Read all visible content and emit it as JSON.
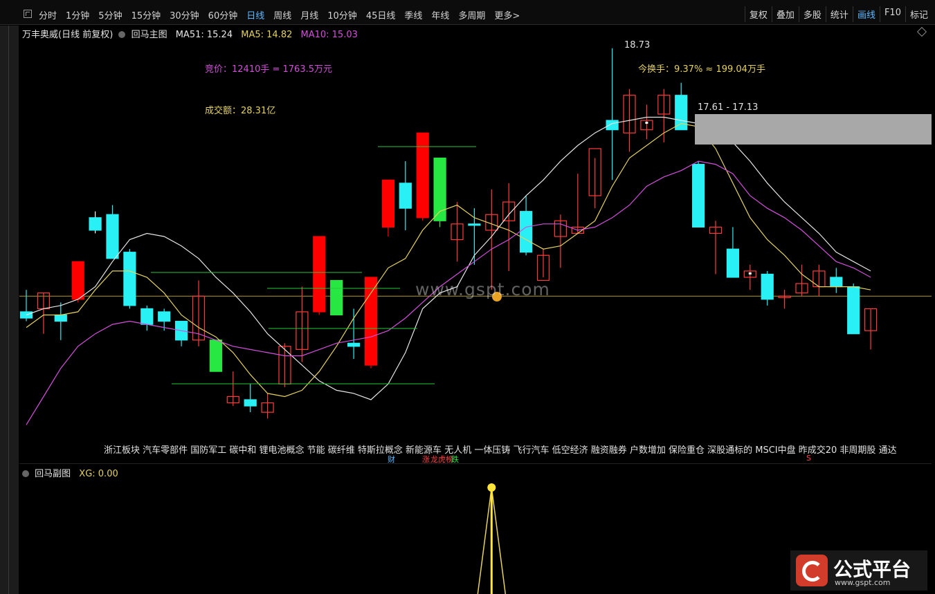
{
  "toolbar": {
    "periods": [
      "分时",
      "1分钟",
      "5分钟",
      "15分钟",
      "30分钟",
      "60分钟",
      "日线",
      "周线",
      "月线",
      "10分钟",
      "45日线",
      "季线",
      "年线",
      "多周期",
      "更多>"
    ],
    "active_period": "日线",
    "tools": [
      "复权",
      "叠加",
      "多股",
      "统计",
      "画线",
      "F10",
      "标记"
    ],
    "active_tool": "画线"
  },
  "main": {
    "stock_title": "万丰奥威(日线 前复权)",
    "indicator_name": "回马主图",
    "ma51": "MA51: 15.24",
    "ma5": "MA5: 14.82",
    "ma10": "MA10: 15.03",
    "bid_text": "竞价：12410手 = 1763.5万元",
    "amount_text": "成交额：28.31亿",
    "turnover_text": "今换手：9.37% ≈ 199.04万手",
    "high_text": "18.73",
    "range_text": "17.61 - 17.13",
    "watermark": "www.gspt.com"
  },
  "tags": {
    "text": "浙江板块 汽车零部件 国防军工 碳中和 锂电池概念 节能 碳纤维 特斯拉概念 新能源车 无人机 一体压铸 飞行汽车 低空经济 融资融券 户数增加 保险重仓 深股通标的 MSCI中盘 昨成交20 非周期股 通达",
    "sig_cai": "财",
    "sig_zhang": "涨",
    "sig_bang": "龙虎榜",
    "sig_die": "跌",
    "sig_s": "S"
  },
  "sub": {
    "indicator_name": "回马副图",
    "xg": "XG: 0.00"
  },
  "logo": {
    "text": "公式平台",
    "url": "www.gspt.com"
  },
  "colors": {
    "up_red": "#ff0000",
    "down_cyan": "#29f0f5",
    "green": "#27e843",
    "ma5": "#e6d25e",
    "ma10": "#d34fdc",
    "ma51": "#e6e6e6",
    "active": "#5cb8ff"
  },
  "chart_data": {
    "type": "candlestick",
    "y_range": [
      12.5,
      19
    ],
    "candles": [
      {
        "o": 14.55,
        "h": 14.9,
        "l": 14.4,
        "c": 14.45,
        "color": "cyan"
      },
      {
        "o": 14.6,
        "h": 14.85,
        "l": 14.2,
        "c": 14.85,
        "color": "hollow"
      },
      {
        "o": 14.5,
        "h": 14.7,
        "l": 14.1,
        "c": 14.4,
        "color": "cyan"
      },
      {
        "o": 14.75,
        "h": 15.35,
        "l": 14.7,
        "c": 15.35,
        "color": "red"
      },
      {
        "o": 16.05,
        "h": 16.15,
        "l": 15.8,
        "c": 15.85,
        "color": "white_cross"
      },
      {
        "o": 16.1,
        "h": 16.25,
        "l": 15.4,
        "c": 15.4,
        "color": "cyan"
      },
      {
        "o": 15.5,
        "h": 15.55,
        "l": 14.6,
        "c": 14.65,
        "color": "cyan"
      },
      {
        "o": 14.6,
        "h": 14.65,
        "l": 14.25,
        "c": 14.35,
        "color": "cyan"
      },
      {
        "o": 14.55,
        "h": 14.6,
        "l": 14.25,
        "c": 14.4,
        "color": "cyan"
      },
      {
        "o": 14.4,
        "h": 14.4,
        "l": 14.0,
        "c": 14.1,
        "color": "cyan"
      },
      {
        "o": 14.1,
        "h": 15.05,
        "l": 14.0,
        "c": 14.8,
        "color": "hollow"
      },
      {
        "o": 14.1,
        "h": 14.1,
        "l": 13.6,
        "c": 13.6,
        "color": "green"
      },
      {
        "o": 13.1,
        "h": 13.6,
        "l": 13.05,
        "c": 13.2,
        "color": "hollow"
      },
      {
        "o": 13.15,
        "h": 13.4,
        "l": 12.95,
        "c": 13.05,
        "color": "cyan"
      },
      {
        "o": 12.95,
        "h": 13.25,
        "l": 12.85,
        "c": 13.1,
        "color": "hollow"
      },
      {
        "o": 13.4,
        "h": 14.05,
        "l": 13.35,
        "c": 14.0,
        "color": "hollow"
      },
      {
        "o": 13.95,
        "h": 14.95,
        "l": 13.75,
        "c": 14.55,
        "color": "hollow"
      },
      {
        "o": 14.55,
        "h": 15.75,
        "l": 14.5,
        "c": 15.75,
        "color": "red"
      },
      {
        "o": 14.5,
        "h": 15.05,
        "l": 14.5,
        "c": 15.05,
        "color": "green"
      },
      {
        "o": 14.0,
        "h": 14.6,
        "l": 13.8,
        "c": 14.05,
        "color": "cyan"
      },
      {
        "o": 13.7,
        "h": 15.1,
        "l": 13.65,
        "c": 15.1,
        "color": "red"
      },
      {
        "o": 15.9,
        "h": 16.6,
        "l": 15.75,
        "c": 16.65,
        "color": "red"
      },
      {
        "o": 16.6,
        "h": 16.95,
        "l": 15.85,
        "c": 16.2,
        "color": "cyan"
      },
      {
        "o": 16.05,
        "h": 17.4,
        "l": 16.0,
        "c": 17.4,
        "color": "red"
      },
      {
        "o": 16.0,
        "h": 17.0,
        "l": 15.9,
        "c": 17.0,
        "color": "green"
      },
      {
        "o": 15.7,
        "h": 16.3,
        "l": 15.35,
        "c": 15.95,
        "color": "hollow"
      },
      {
        "o": 15.95,
        "h": 16.2,
        "l": 15.3,
        "c": 15.95,
        "color": "cyan_flat"
      },
      {
        "o": 15.85,
        "h": 16.5,
        "l": 14.9,
        "c": 16.1,
        "color": "hollow"
      },
      {
        "o": 16.0,
        "h": 16.6,
        "l": 15.2,
        "c": 16.3,
        "color": "hollow"
      },
      {
        "o": 16.15,
        "h": 16.4,
        "l": 15.45,
        "c": 15.5,
        "color": "cyan"
      },
      {
        "o": 15.45,
        "h": 15.55,
        "l": 15.1,
        "c": 15.05,
        "color": "hollow"
      },
      {
        "o": 15.75,
        "h": 16.1,
        "l": 15.25,
        "c": 16.0,
        "color": "hollow"
      },
      {
        "o": 15.8,
        "h": 16.75,
        "l": 15.8,
        "c": 15.9,
        "color": "hollow"
      },
      {
        "o": 16.4,
        "h": 17.0,
        "l": 16.2,
        "c": 17.15,
        "color": "hollow"
      },
      {
        "o": 17.45,
        "h": 18.75,
        "l": 16.65,
        "c": 17.6,
        "color": "cyan"
      },
      {
        "o": 17.4,
        "h": 18.1,
        "l": 17.1,
        "c": 18.0,
        "color": "hollow"
      },
      {
        "o": 17.6,
        "h": 17.85,
        "l": 17.3,
        "c": 17.45,
        "color": "hollow_white"
      },
      {
        "o": 17.7,
        "h": 18.1,
        "l": 17.25,
        "c": 18.0,
        "color": "hollow"
      },
      {
        "o": 18.0,
        "h": 18.2,
        "l": 17.45,
        "c": 17.45,
        "color": "cyan"
      },
      {
        "o": 16.9,
        "h": 16.95,
        "l": 15.9,
        "c": 15.9,
        "color": "cyan"
      },
      {
        "o": 15.9,
        "h": 16.0,
        "l": 15.15,
        "c": 15.8,
        "color": "hollow"
      },
      {
        "o": 15.55,
        "h": 15.9,
        "l": 15.1,
        "c": 15.1,
        "color": "cyan"
      },
      {
        "o": 15.1,
        "h": 15.3,
        "l": 14.9,
        "c": 15.2,
        "color": "hollow_white"
      },
      {
        "o": 15.15,
        "h": 15.2,
        "l": 14.65,
        "c": 14.75,
        "color": "cyan"
      },
      {
        "o": 14.8,
        "h": 14.9,
        "l": 14.6,
        "c": 14.8,
        "color": "doji"
      },
      {
        "o": 14.85,
        "h": 15.3,
        "l": 14.8,
        "c": 15.0,
        "color": "hollow"
      },
      {
        "o": 14.95,
        "h": 15.3,
        "l": 14.8,
        "c": 15.2,
        "color": "hollow"
      },
      {
        "o": 15.1,
        "h": 15.25,
        "l": 14.85,
        "c": 14.95,
        "color": "cyan"
      },
      {
        "o": 14.95,
        "h": 15.0,
        "l": 14.2,
        "c": 14.2,
        "color": "cyan"
      },
      {
        "o": 14.25,
        "h": 14.6,
        "l": 13.95,
        "c": 14.6,
        "color": "hollow"
      }
    ],
    "ma51": [
      14.5,
      14.6,
      14.65,
      14.75,
      14.95,
      15.35,
      15.7,
      15.8,
      15.75,
      15.6,
      15.4,
      15.1,
      14.85,
      14.55,
      14.2,
      13.95,
      13.7,
      13.45,
      13.3,
      13.25,
      13.15,
      13.4,
      13.9,
      14.6,
      14.85,
      14.95,
      15.45,
      15.75,
      16.1,
      16.4,
      16.65,
      16.95,
      17.2,
      17.4,
      17.55,
      17.6,
      17.65,
      17.65,
      17.6,
      17.55,
      17.55,
      17.25,
      16.95,
      16.6,
      16.3,
      16.05,
      15.8,
      15.5,
      15.35,
      15.2
    ],
    "ma5": [
      14.3,
      14.5,
      14.5,
      14.55,
      14.9,
      15.2,
      15.2,
      15.1,
      14.85,
      14.5,
      14.3,
      14.15,
      13.9,
      13.55,
      13.25,
      13.2,
      13.3,
      13.6,
      14.0,
      14.45,
      14.85,
      15.25,
      15.4,
      15.85,
      16.15,
      16.25,
      16.05,
      15.95,
      15.85,
      15.7,
      15.55,
      15.6,
      15.8,
      16.0,
      16.55,
      17.0,
      17.2,
      17.4,
      17.55,
      17.5,
      17.15,
      16.6,
      16.05,
      15.7,
      15.45,
      15.15,
      14.95,
      14.95,
      14.95,
      14.9
    ],
    "ma10": [
      12.75,
      13.2,
      13.65,
      14.0,
      14.2,
      14.35,
      14.4,
      14.35,
      14.3,
      14.25,
      14.2,
      14.1,
      14.0,
      13.95,
      13.9,
      13.85,
      13.85,
      13.95,
      14.05,
      14.1,
      14.15,
      14.25,
      14.45,
      14.7,
      14.95,
      15.15,
      15.35,
      15.55,
      15.7,
      15.9,
      15.95,
      15.95,
      15.85,
      15.9,
      16.05,
      16.25,
      16.55,
      16.7,
      16.8,
      16.95,
      16.9,
      16.75,
      16.4,
      16.2,
      16.05,
      15.85,
      15.6,
      15.35,
      15.25,
      15.1
    ],
    "level_lines": [
      14.8
    ],
    "sub_chart": {
      "indicator": "XG",
      "peak_index": 27,
      "peak_value": 1
    }
  }
}
